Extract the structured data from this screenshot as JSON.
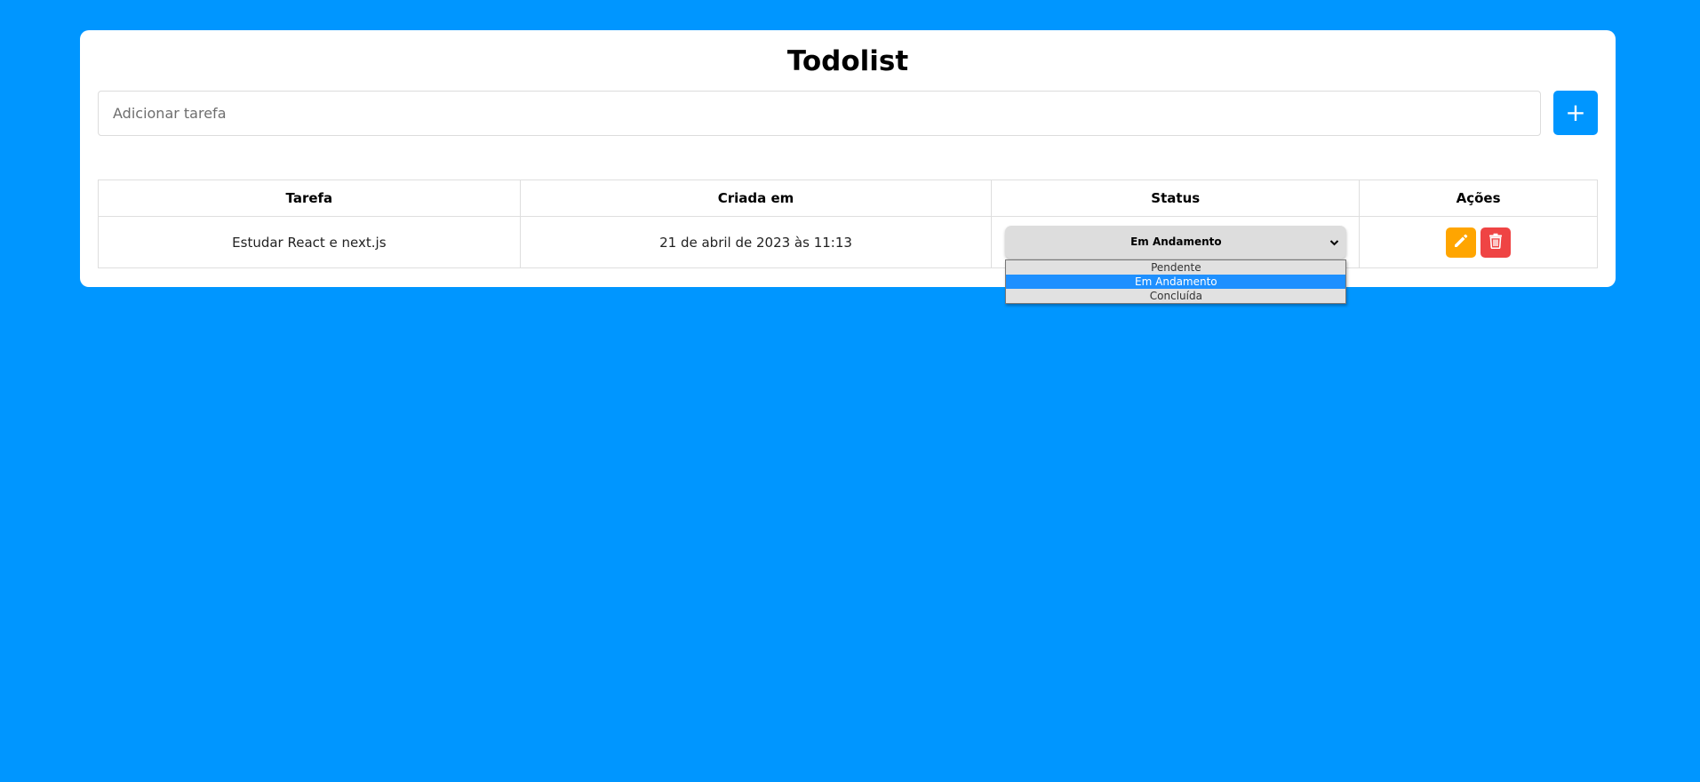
{
  "app": {
    "title": "Todolist"
  },
  "add_task": {
    "placeholder": "Adicionar tarefa",
    "button_label": "+"
  },
  "table": {
    "headers": [
      "Tarefa",
      "Criada em",
      "Status",
      "Ações"
    ],
    "rows": [
      {
        "task": "Estudar React e next.js",
        "created_at": "21 de abril de 2023 às 11:13",
        "status": "Em Andamento"
      }
    ]
  },
  "status_dropdown": {
    "options": [
      "Pendente",
      "Em Andamento",
      "Concluída"
    ],
    "selected": "Em Andamento"
  },
  "icons": {
    "edit": "pencil-icon",
    "delete": "trash-icon",
    "dropdown": "chevron-down-icon"
  },
  "colors": {
    "background": "#0096ff",
    "add_button": "#0096ff",
    "edit_button": "#ffa500",
    "delete_button": "#ef4444",
    "selected_option": "#1e90ff"
  }
}
